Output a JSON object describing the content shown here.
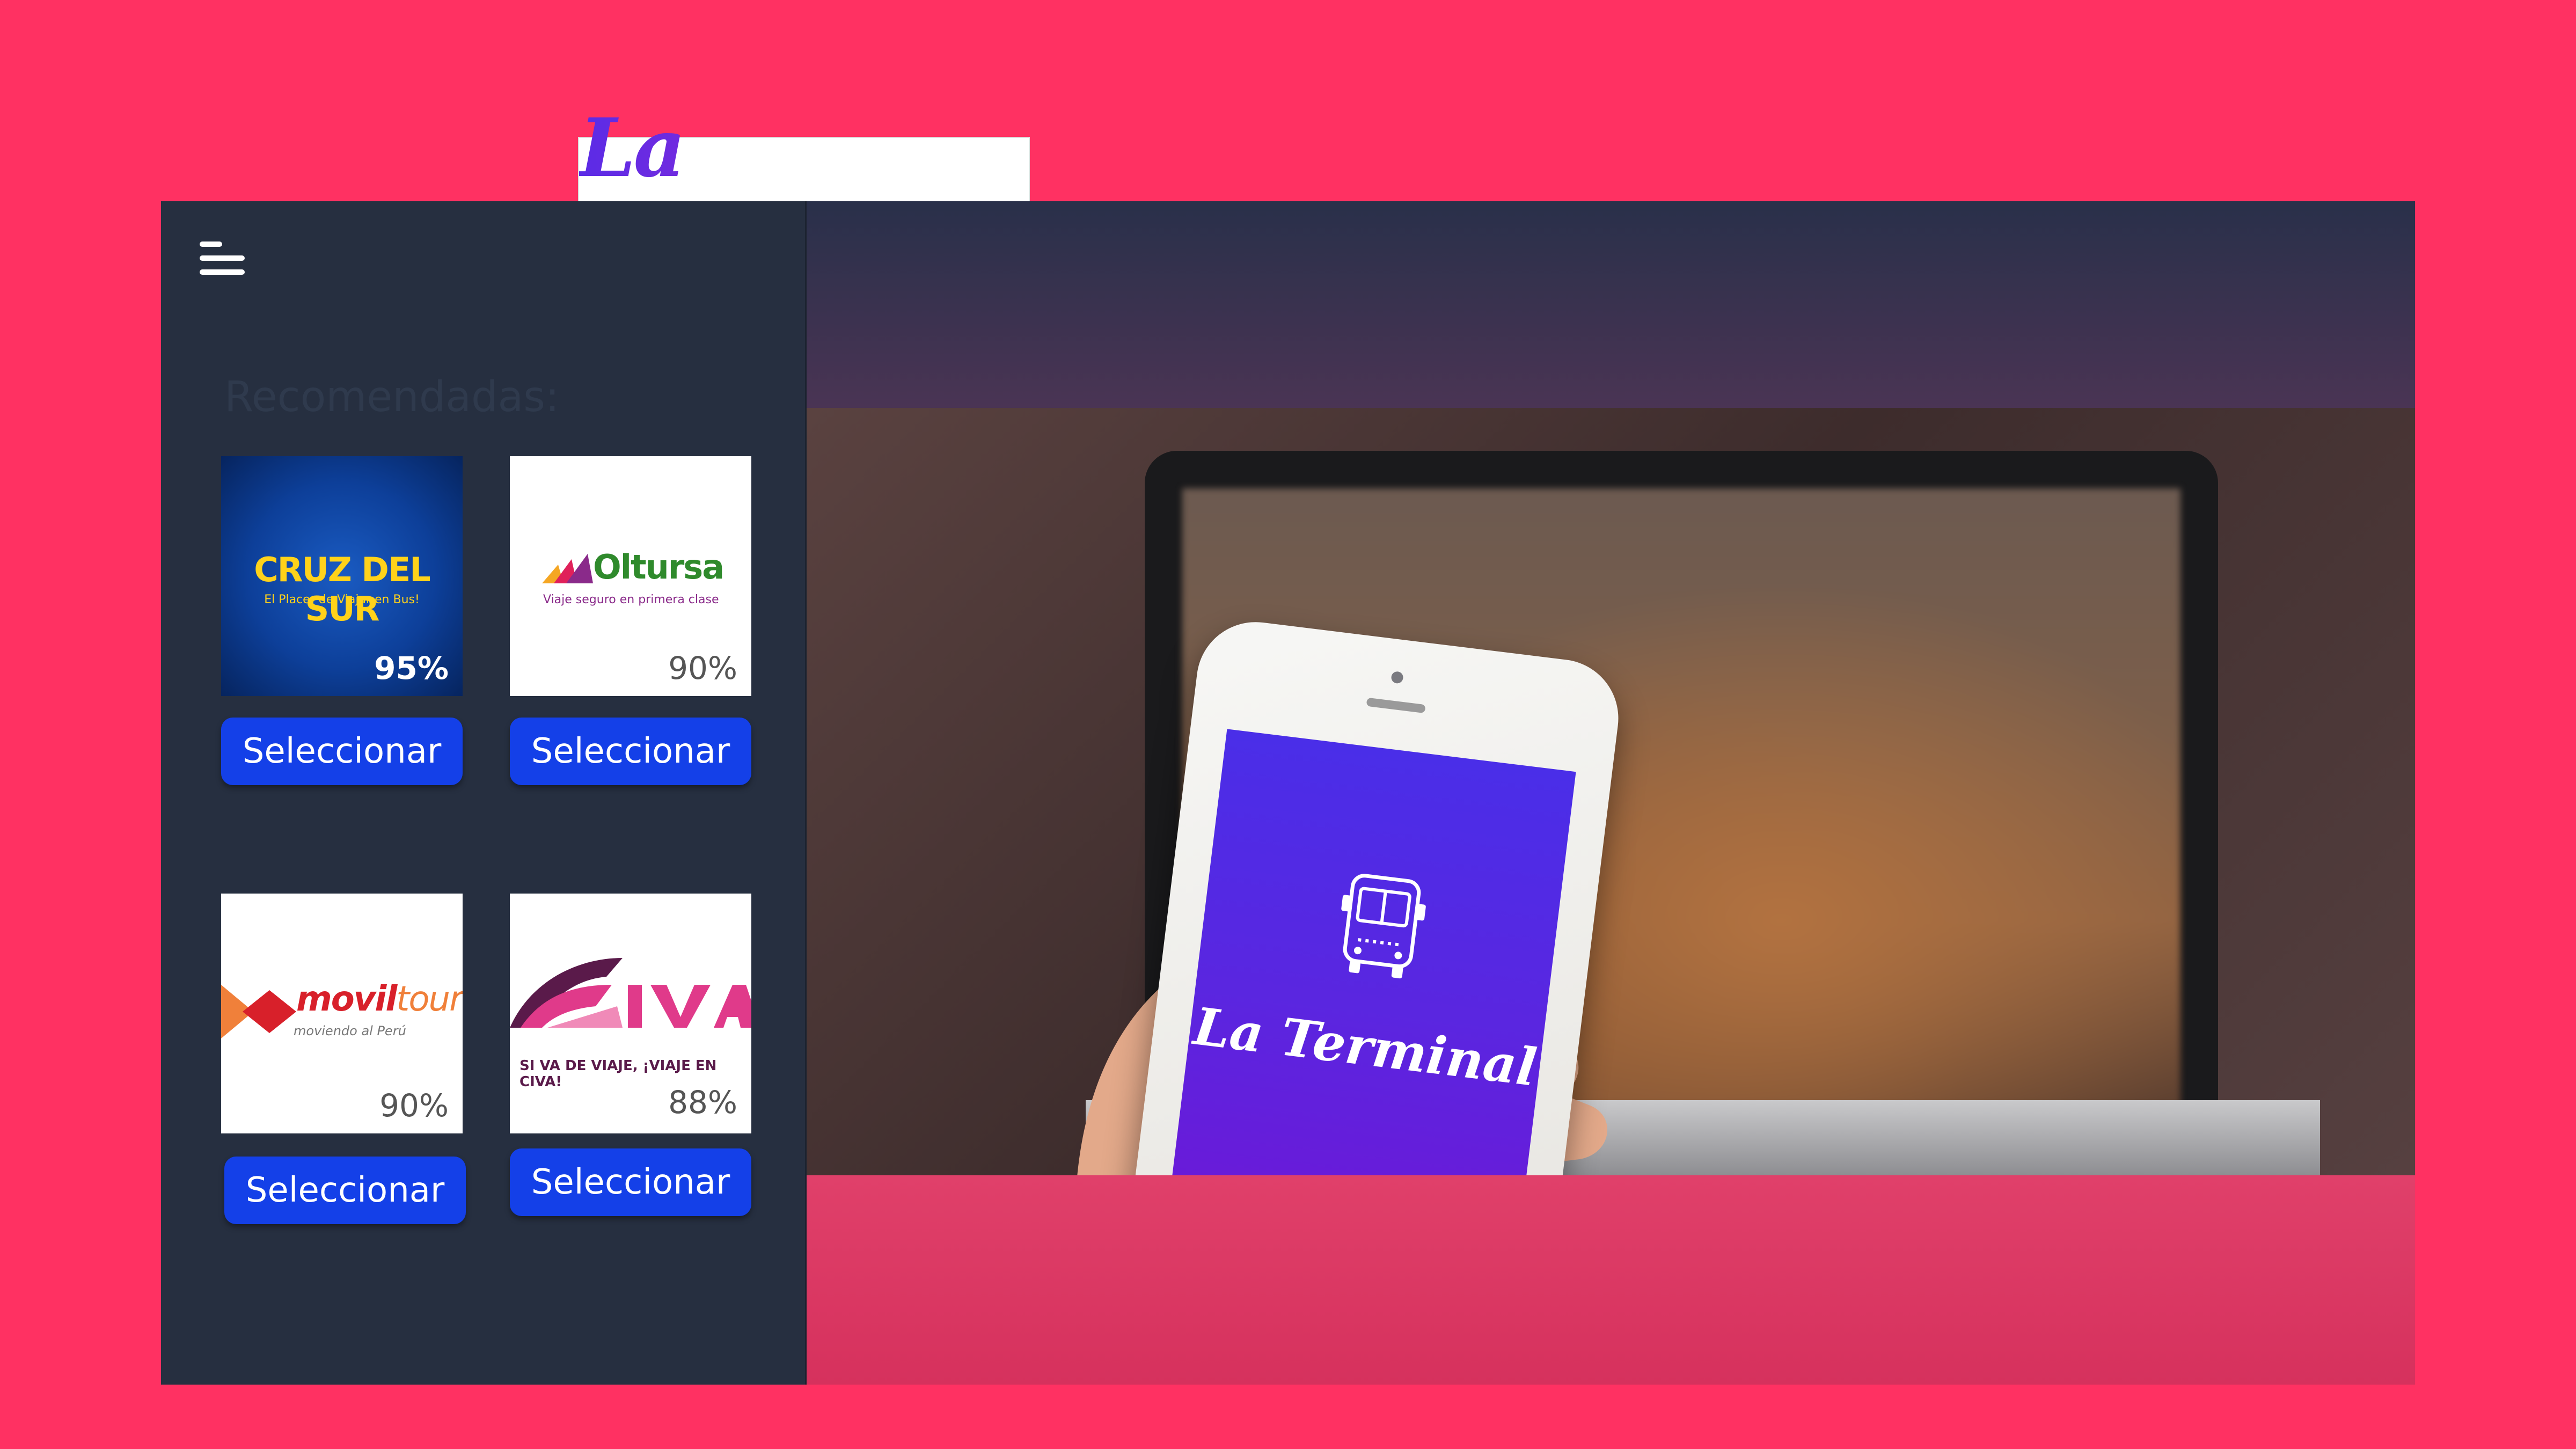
{
  "header": {
    "logo_text": "La Terminal"
  },
  "sidebar": {
    "section_title": "Recomendadas:",
    "cards": [
      {
        "brand": "CRUZ DEL SUR",
        "tagline": "El Placer de Viajar en Bus!",
        "percent": "95%",
        "button_label": "Seleccionar"
      },
      {
        "brand": "Oltursa",
        "tagline": "Viaje seguro en primera clase",
        "percent": "90%",
        "button_label": "Seleccionar"
      },
      {
        "brand_bold": "movil",
        "brand_light": "tours",
        "tagline": "moviendo al Perú",
        "percent": "90%",
        "button_label": "Seleccionar"
      },
      {
        "brand": "CIVA",
        "tagline": "SI VA DE VIAJE, ¡VIAJE EN CIVA!",
        "percent": "88%",
        "button_label": "Seleccionar"
      }
    ]
  },
  "hero": {
    "phone_brand": "La Terminal",
    "phone_icon": "bus-icon"
  },
  "colors": {
    "background": "#ff3162",
    "sidebar": "#262f40",
    "button": "#1440e8",
    "phone_screen": "#5a26e0"
  },
  "icons": [
    "menu-icon",
    "bus-icon"
  ]
}
